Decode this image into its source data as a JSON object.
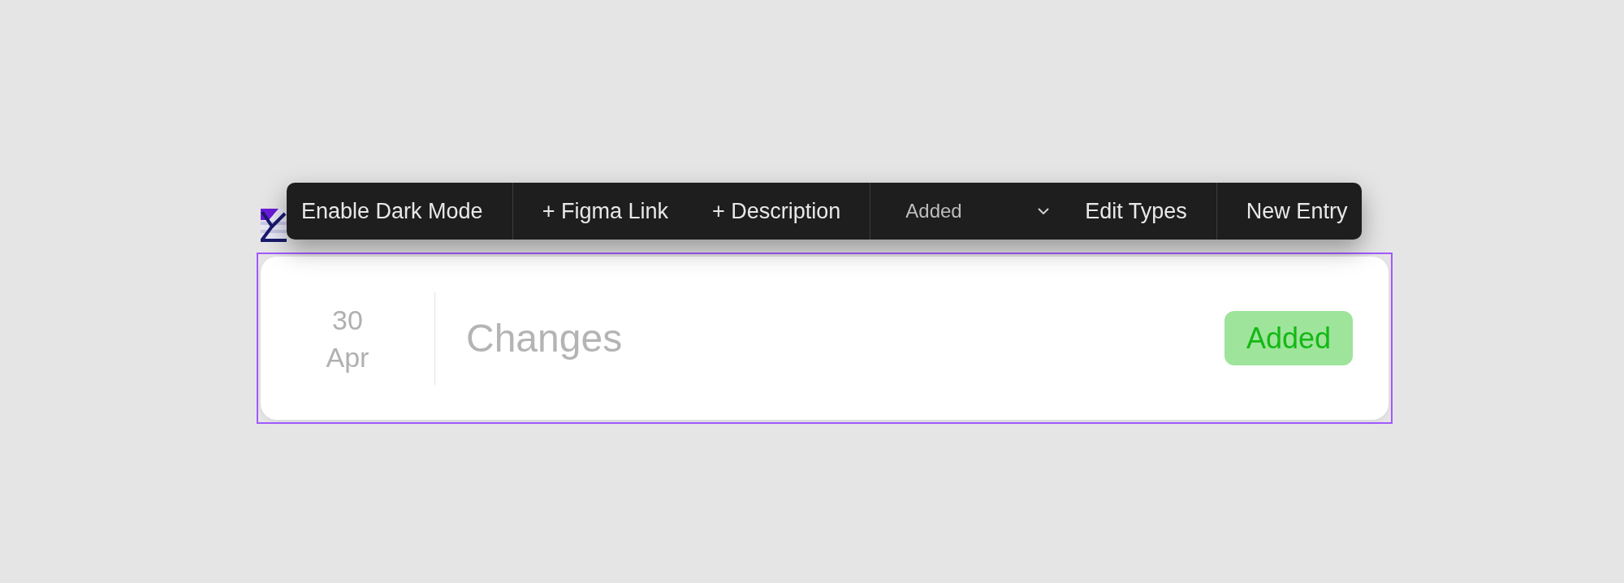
{
  "toolbar": {
    "groups": [
      {
        "items": [
          {
            "kind": "button",
            "label": "Enable Dark Mode"
          }
        ]
      },
      {
        "items": [
          {
            "kind": "button",
            "label": "+ Figma Link"
          },
          {
            "kind": "button",
            "label": "+ Description"
          }
        ]
      },
      {
        "items": [
          {
            "kind": "select",
            "value": "Added"
          },
          {
            "kind": "button",
            "label": "Edit Types"
          }
        ]
      },
      {
        "items": [
          {
            "kind": "button",
            "label": "New Entry"
          }
        ]
      }
    ]
  },
  "entry": {
    "selected": true,
    "date": {
      "day": "30",
      "month": "Apr"
    },
    "title": "Changes",
    "tag": "Added"
  }
}
